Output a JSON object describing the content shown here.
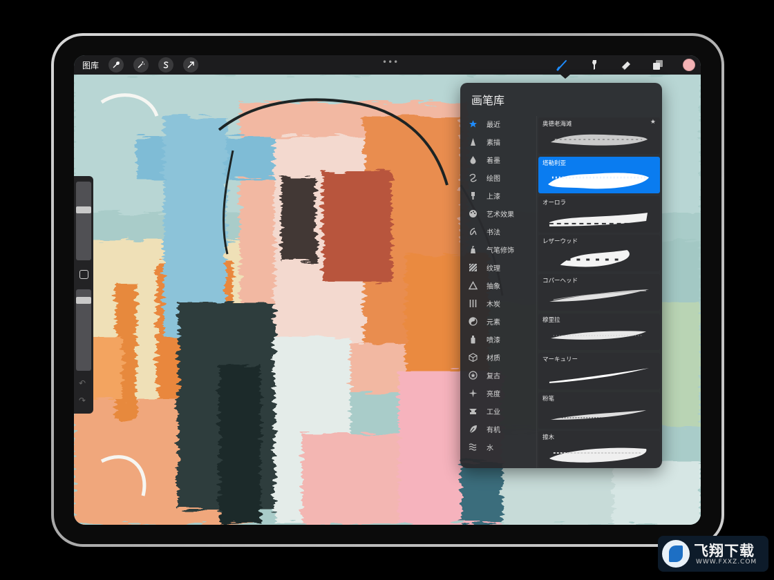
{
  "toolbar": {
    "gallery_label": "图库",
    "more_dots": "•••",
    "left_tools": [
      "wrench-icon",
      "magic-wand-icon",
      "selection-s-icon",
      "transform-arrow-icon"
    ],
    "right_tools": [
      "brush-icon",
      "smudge-icon",
      "eraser-icon",
      "layers-icon"
    ],
    "active_tool": "brush-icon",
    "current_color": "#f4b3b5"
  },
  "sidebar": {
    "size_slider_level": 0.35,
    "opacity_slider_level": 0.1,
    "undo_glyph": "↶",
    "redo_glyph": "↷"
  },
  "brush_library": {
    "title": "画笔库",
    "categories": [
      {
        "label": "最近",
        "icon": "star-icon"
      },
      {
        "label": "素描",
        "icon": "pencil-tip-icon"
      },
      {
        "label": "着墨",
        "icon": "ink-drop-icon"
      },
      {
        "label": "绘图",
        "icon": "swirl-icon"
      },
      {
        "label": "上漆",
        "icon": "paint-brush-icon"
      },
      {
        "label": "艺术效果",
        "icon": "palette-icon"
      },
      {
        "label": "书法",
        "icon": "calligraphy-icon"
      },
      {
        "label": "气笔修饰",
        "icon": "airbrush-icon"
      },
      {
        "label": "纹理",
        "icon": "texture-icon"
      },
      {
        "label": "抽象",
        "icon": "triangle-icon"
      },
      {
        "label": "木炭",
        "icon": "charcoal-icon"
      },
      {
        "label": "元素",
        "icon": "yin-yang-icon"
      },
      {
        "label": "喷漆",
        "icon": "spray-can-icon"
      },
      {
        "label": "材质",
        "icon": "cube-icon"
      },
      {
        "label": "复古",
        "icon": "retro-star-icon"
      },
      {
        "label": "亮度",
        "icon": "sparkle-icon"
      },
      {
        "label": "工业",
        "icon": "anvil-icon"
      },
      {
        "label": "有机",
        "icon": "leaf-icon"
      },
      {
        "label": "水",
        "icon": "waves-icon"
      }
    ],
    "brushes": [
      {
        "name": "奥德老海滩",
        "starred": true
      },
      {
        "name": "塔勒利亚",
        "selected": true
      },
      {
        "name": "オーロラ"
      },
      {
        "name": "レザーウッド"
      },
      {
        "name": "コパーヘッド"
      },
      {
        "name": "穆里拉"
      },
      {
        "name": "マーキュリー"
      },
      {
        "name": "粉笔"
      },
      {
        "name": "擦木"
      }
    ],
    "star_glyph": "★",
    "accent_color": "#0a7cf0"
  },
  "watermark": {
    "name": "飞翔下载",
    "url": "WWW.FXXZ.COM"
  }
}
